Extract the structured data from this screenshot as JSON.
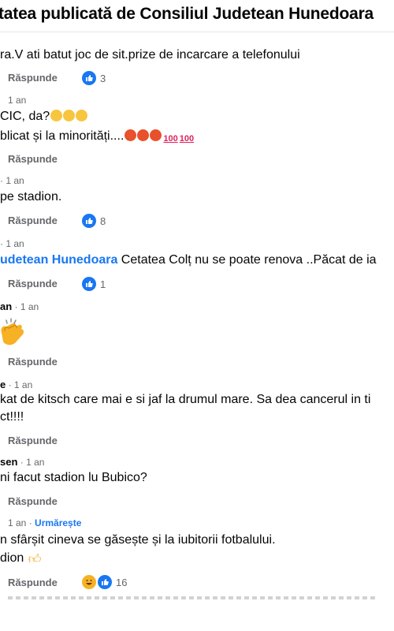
{
  "header": {
    "title": "tatea publicată de Consiliul Judetean Hunedoara"
  },
  "reply_label": "Răspunde",
  "colors": {
    "accent": "#1877f2",
    "muted": "#65676b",
    "text": "#050505"
  },
  "comments": [
    {
      "text": "ra.V ati batut joc de sit.prize de incarcare a telefonului",
      "reaction_count": "3",
      "reaction_icon": "like-icon"
    },
    {
      "meta": "1 an",
      "text_line1": "CIC, da?",
      "text_line2": "blicat și la minorități....",
      "text_line2_suffix": ""
    },
    {
      "meta": "· 1 an",
      "text": "pe stadion.",
      "reaction_count": "8",
      "reaction_icon": "like-icon"
    },
    {
      "meta": "· 1 an",
      "mention": "udetean Hunedoara",
      "text": " Cetatea Colț nu se poate renova ..Păcat de ia",
      "reaction_count": "1",
      "reaction_icon": "like-icon"
    },
    {
      "author": "an",
      "meta": "· 1 an"
    },
    {
      "author": "e",
      "meta": "· 1 an",
      "text_line1": "kat de kitsch care mai e si jaf la drumul mare. Sa dea cancerul in ti",
      "text_line2": "ct!!!!"
    },
    {
      "author": "sen",
      "meta": "· 1 an",
      "text": "ni facut stadion lu Bubico?"
    },
    {
      "meta": "1 an ·",
      "follow": "Urmărește",
      "text_line1": "n sfârșit cineva se găsește și la iubitorii fotbalului.",
      "text_line2": "dion",
      "reaction_count": "16",
      "reaction_icon": "haha-like-icons"
    }
  ]
}
